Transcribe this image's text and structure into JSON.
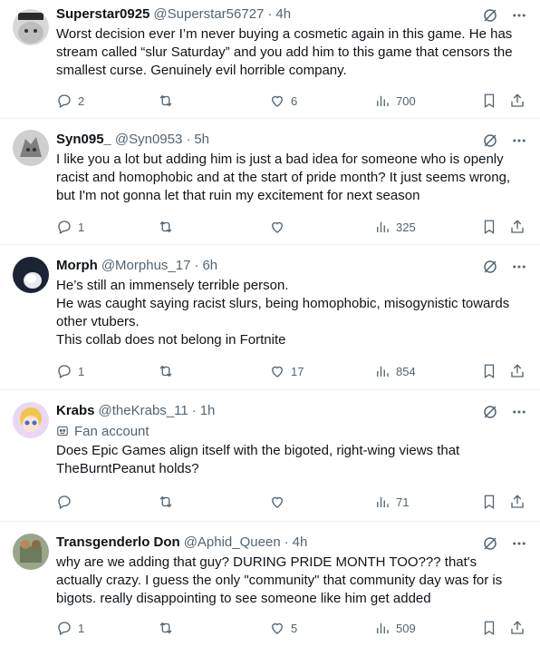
{
  "tweets": [
    {
      "name": "Superstar0925",
      "handle": "@Superstar56727",
      "time": "4h",
      "fan_account": "",
      "text": "Worst decision ever I’m never buying a cosmetic again in this game. He has stream called “slur Saturday” and you add him to this game that censors the smallest curse. Genuinely evil horrible company.",
      "replies": "2",
      "reposts": "",
      "likes": "6",
      "views": "700",
      "avatar_color": "#c9c9c9"
    },
    {
      "name": "Syn095_",
      "handle": "@Syn0953",
      "time": "5h",
      "fan_account": "",
      "text": "I like you a lot but adding him is just a bad idea for someone who is openly racist and homophobic and at the start of pride month? It just seems wrong, but I'm not gonna let that ruin my excitement for next season",
      "replies": "1",
      "reposts": "",
      "likes": "",
      "views": "325",
      "avatar_color": "#9a9a9a"
    },
    {
      "name": "Morph",
      "handle": "@Morphus_17",
      "time": "6h",
      "fan_account": "",
      "text": "He’s still an immensely terrible person.\nHe was caught saying racist slurs, being homophobic, misogynistic towards other vtubers.\nThis collab does not belong in Fortnite",
      "replies": "1",
      "reposts": "",
      "likes": "17",
      "views": "854",
      "avatar_color": "#1c2333"
    },
    {
      "name": "Krabs",
      "handle": "@theKrabs_11",
      "time": "1h",
      "fan_account": "Fan account",
      "text": "Does Epic Games align itself with the bigoted, right-wing views that TheBurntPeanut holds?",
      "replies": "",
      "reposts": "",
      "likes": "",
      "views": "71",
      "avatar_color": "#f0c64a"
    },
    {
      "name": "Transgenderlo Don",
      "handle": "@Aphid_Queen",
      "time": "4h",
      "fan_account": "",
      "text": "why are we adding that guy? DURING PRIDE MONTH TOO??? that's actually crazy. I guess the only \"community\" that community day was for is bigots. really disappointing to see someone like him get added",
      "replies": "1",
      "reposts": "",
      "likes": "5",
      "views": "509",
      "avatar_color": "#8a9a7a"
    }
  ],
  "colors": {
    "text": "#0f1419",
    "muted": "#536471",
    "divider": "#eff3f4"
  },
  "icons": [
    "grok-icon",
    "more-icon",
    "reply-icon",
    "repost-icon",
    "like-icon",
    "views-icon",
    "bookmark-icon",
    "share-icon",
    "fan-badge-icon"
  ]
}
